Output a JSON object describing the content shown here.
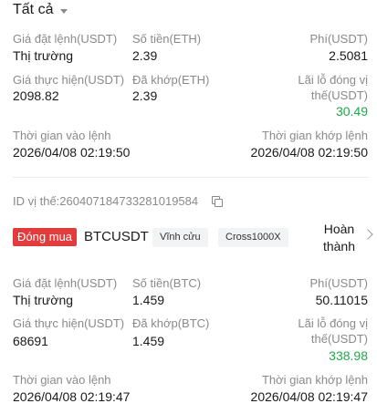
{
  "filter": {
    "label": "Tất cả"
  },
  "order1": {
    "order_price_label": "Giá đặt lệnh(USDT)",
    "order_price": "Thị trường",
    "amount_label": "Số tiền(ETH)",
    "amount": "2.39",
    "fee_label": "Phí(USDT)",
    "fee": "2.5081",
    "exec_price_label": "Giá thực hiện(USDT)",
    "exec_price": "2098.82",
    "filled_label": "Đã khớp(ETH)",
    "filled": "2.39",
    "pnl_label_line1": "Lãi lỗ đóng vị",
    "pnl_label_line2": "thế(USDT)",
    "pnl": "30.49",
    "open_time_label": "Thời gian vào lệnh",
    "open_time": "2026/04/08 02:19:50",
    "match_time_label": "Thời gian khớp lệnh",
    "match_time": "2026/04/08 02:19:50"
  },
  "order2": {
    "position_id": "ID vị thế:260407184733281019584",
    "side": "Đóng mua",
    "symbol": "BTCUSDT",
    "tag1": "Vĩnh cửu",
    "tag2": "Cross1000X",
    "status_line1": "Hoàn",
    "status_line2": "thành",
    "order_price_label": "Giá đặt lệnh(USDT)",
    "order_price": "Thị trường",
    "amount_label": "Số tiền(BTC)",
    "amount": "1.459",
    "fee_label": "Phí(USDT)",
    "fee": "50.11015",
    "exec_price_label": "Giá thực hiện(USDT)",
    "exec_price": "68691",
    "filled_label": "Đã khớp(BTC)",
    "filled": "1.459",
    "pnl_label_line1": "Lãi lỗ đóng vị",
    "pnl_label_line2": "thế(USDT)",
    "pnl": "338.98",
    "open_time_label": "Thời gian vào lệnh",
    "open_time": "2026/04/08 02:19:47",
    "match_time_label": "Thời gian khớp lệnh",
    "match_time": "2026/04/08 02:19:47"
  },
  "colors": {
    "profit": "#1fa84a",
    "side_close_buy": "#e23b3b"
  },
  "icons": {
    "filter_caret": "caret-down-icon",
    "copy": "copy-icon",
    "detail": "chevron-right-icon"
  }
}
